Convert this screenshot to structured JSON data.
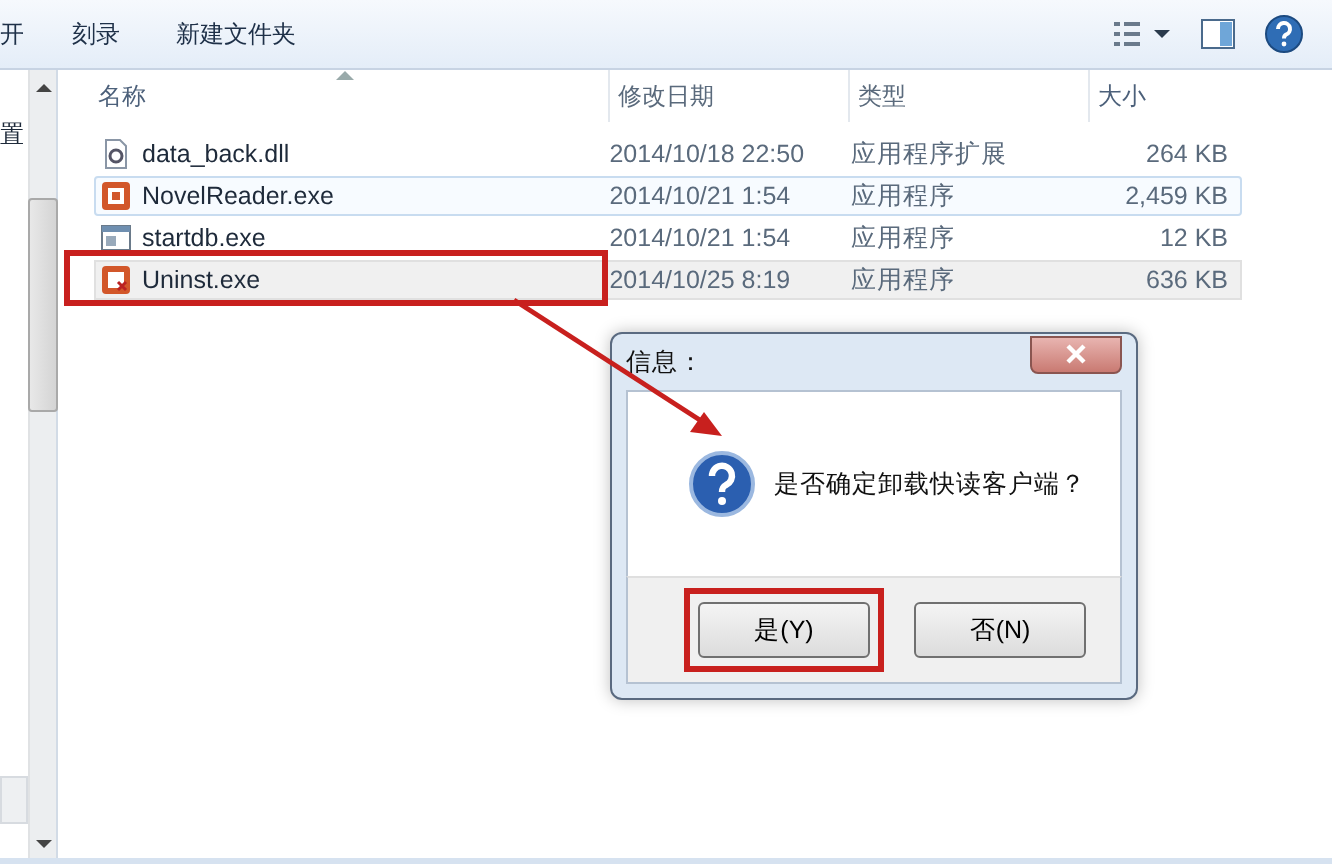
{
  "toolbar": {
    "items": [
      "开",
      "刻录",
      "新建文件夹"
    ]
  },
  "sidebar": {
    "items": [
      "置"
    ]
  },
  "columns": [
    "名称",
    "修改日期",
    "类型",
    "大小"
  ],
  "files": [
    {
      "name": "data_back.dll",
      "date": "2014/10/18 22:50",
      "type": "应用程序扩展",
      "size": "264 KB",
      "kind": "dll",
      "hovered": false,
      "selected": false,
      "highlighted": false
    },
    {
      "name": "NovelReader.exe",
      "date": "2014/10/21 1:54",
      "type": "应用程序",
      "size": "2,459 KB",
      "kind": "app",
      "hovered": true,
      "selected": false,
      "highlighted": false
    },
    {
      "name": "startdb.exe",
      "date": "2014/10/21 1:54",
      "type": "应用程序",
      "size": "12 KB",
      "kind": "window",
      "hovered": false,
      "selected": false,
      "highlighted": false
    },
    {
      "name": "Uninst.exe",
      "date": "2014/10/25 8:19",
      "type": "应用程序",
      "size": "636 KB",
      "kind": "uninstaller",
      "hovered": false,
      "selected": true,
      "highlighted": true
    }
  ],
  "dialog": {
    "title": "信息：",
    "message": "是否确定卸载快读客户端？",
    "buttons": [
      {
        "label": "是(Y)",
        "highlighted": true
      },
      {
        "label": "否(N)",
        "highlighted": false
      }
    ]
  }
}
